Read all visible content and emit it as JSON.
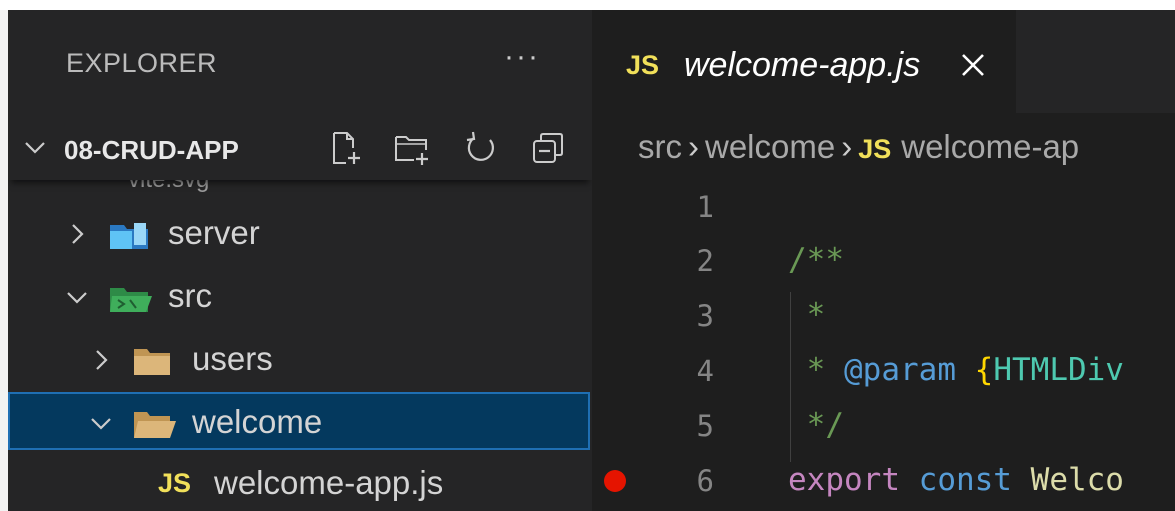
{
  "explorer": {
    "title": "EXPLORER",
    "more_label": "···",
    "project": "08-CRUD-APP",
    "partial_item": "vite.svg",
    "items": [
      {
        "label": "server",
        "type": "folder",
        "state": "collapsed",
        "color": "#3fa9f5"
      },
      {
        "label": "src",
        "type": "folder",
        "state": "expanded",
        "color": "#3fae5b"
      },
      {
        "label": "users",
        "type": "folder",
        "state": "collapsed",
        "color": "#dcb67a"
      },
      {
        "label": "welcome",
        "type": "folder",
        "state": "expanded",
        "selected": true,
        "color": "#dcb67a"
      },
      {
        "label": "welcome-app.js",
        "type": "file",
        "badge": "JS"
      }
    ]
  },
  "editor": {
    "tab": {
      "badge": "JS",
      "title": "welcome-app.js"
    },
    "breadcrumb": {
      "part1": "src",
      "part2": "welcome",
      "badge": "JS",
      "part3": "welcome-ap"
    },
    "line_numbers": [
      "1",
      "2",
      "3",
      "4",
      "5",
      "6"
    ],
    "code": {
      "line2": "/**",
      "line3": " *",
      "line4_star": " * ",
      "line4_param": "@param",
      "line4_brace": "{",
      "line4_type": "HTMLDiv",
      "line5": " */",
      "line6_export": "export",
      "line6_const": "const",
      "line6_name": "Welco"
    },
    "breakpoint_line": "6"
  },
  "colors": {
    "sidebar_bg": "#252526",
    "editor_bg": "#1e1e1e",
    "selection_bg": "#04395e",
    "selection_border": "#1f6fb3",
    "js_badge": "#f1e05a",
    "breakpoint": "#e51400"
  }
}
